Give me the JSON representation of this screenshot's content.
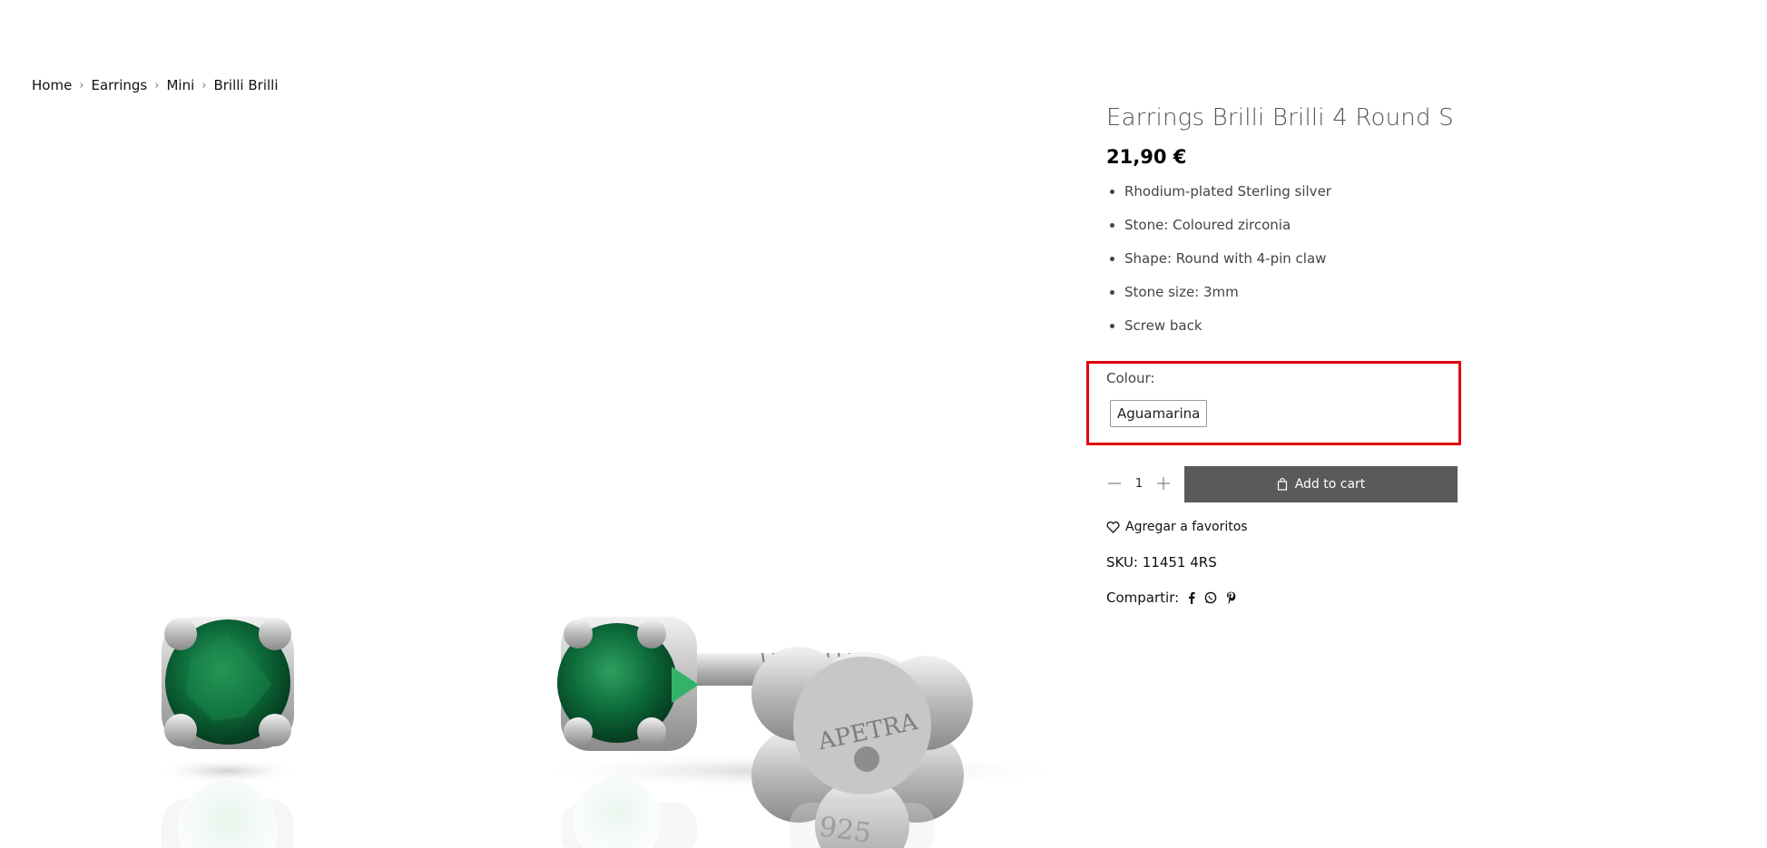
{
  "breadcrumb": {
    "items": [
      "Home",
      "Earrings",
      "Mini",
      "Brilli Brilli"
    ]
  },
  "product": {
    "title": "Earrings Brilli Brilli 4 Round S",
    "price": "21,90 €",
    "features": [
      "Rhodium-plated Sterling silver",
      "Stone: Coloured zirconia",
      "Shape: Round with 4-pin claw",
      "Stone size: 3mm",
      "Screw back"
    ],
    "colour_label": "Colour:",
    "colour_option": "Aguamarina",
    "quantity": "1",
    "add_to_cart": "Add to cart",
    "favorite": "Agregar a favoritos",
    "sku": "SKU: 11451 4RS",
    "share_label": "Compartir:",
    "share_icons": [
      "facebook-icon",
      "whatsapp-icon",
      "pinterest-icon"
    ]
  },
  "image": {
    "stamp_text_top": "APETRA",
    "stamp_text_bottom": "925"
  },
  "colors": {
    "accent_red": "#e0000f",
    "button_bg": "#5a5a5a",
    "gem_green": "#0d6b3a"
  }
}
